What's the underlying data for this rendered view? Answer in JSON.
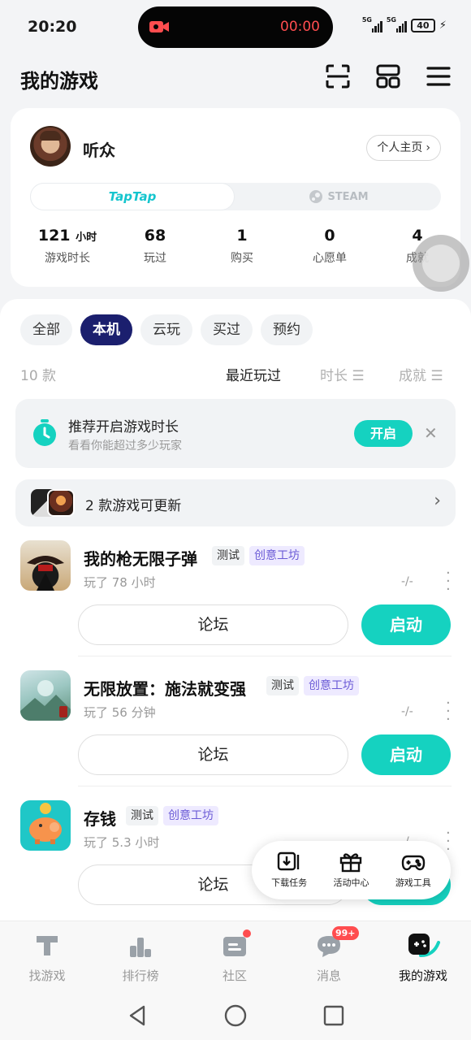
{
  "status": {
    "time": "20:20",
    "rec_timer": "00:00",
    "battery": "40",
    "net1": "5G",
    "net2": "5G"
  },
  "header": {
    "title": "我的游戏"
  },
  "profile": {
    "username": "听众",
    "homepage_link": "个人主页",
    "platform_tabs": [
      "TapTap",
      "STEAM"
    ],
    "stats": [
      {
        "value": "121",
        "unit": "小时",
        "label": "游戏时长"
      },
      {
        "value": "68",
        "label": "玩过"
      },
      {
        "value": "1",
        "label": "购买"
      },
      {
        "value": "0",
        "label": "心愿单"
      },
      {
        "value": "4",
        "label": "成就"
      }
    ]
  },
  "filters": [
    "全部",
    "本机",
    "云玩",
    "买过",
    "预约"
  ],
  "active_filter": "本机",
  "list": {
    "count": "10 款",
    "sort_options": [
      "最近玩过",
      "时长",
      "成就"
    ],
    "recommend": {
      "title": "推荐开启游戏时长",
      "subtitle": "看看你能超过多少玩家",
      "button": "开启"
    },
    "update_notice": "2 款游戏可更新",
    "games": [
      {
        "name": "我的枪无限子弹",
        "tags": [
          "测试",
          "创意工坊"
        ],
        "played": "玩了 78 小时",
        "score": "-/-",
        "forum": "论坛",
        "launch": "启动"
      },
      {
        "name": "无限放置：施法就变强",
        "tags": [
          "测试",
          "创意工坊"
        ],
        "played": "玩了 56 分钟",
        "score": "-/-",
        "forum": "论坛",
        "launch": "启动"
      },
      {
        "name": "存钱",
        "tags": [
          "测试",
          "创意工坊"
        ],
        "played": "玩了 5.3 小时",
        "score": "-/-",
        "forum": "论坛",
        "launch": "启动"
      }
    ]
  },
  "quick_menu": [
    "下载任务",
    "活动中心",
    "游戏工具"
  ],
  "tabbar": [
    {
      "label": "找游戏"
    },
    {
      "label": "排行榜"
    },
    {
      "label": "社区"
    },
    {
      "label": "消息",
      "badge": "99+"
    },
    {
      "label": "我的游戏"
    }
  ],
  "colors": {
    "accent": "#15d2c0",
    "brand_taptap": "#15c5ce",
    "chip_active": "#1b1f6e",
    "tag_purple": "#6b5bd6"
  }
}
